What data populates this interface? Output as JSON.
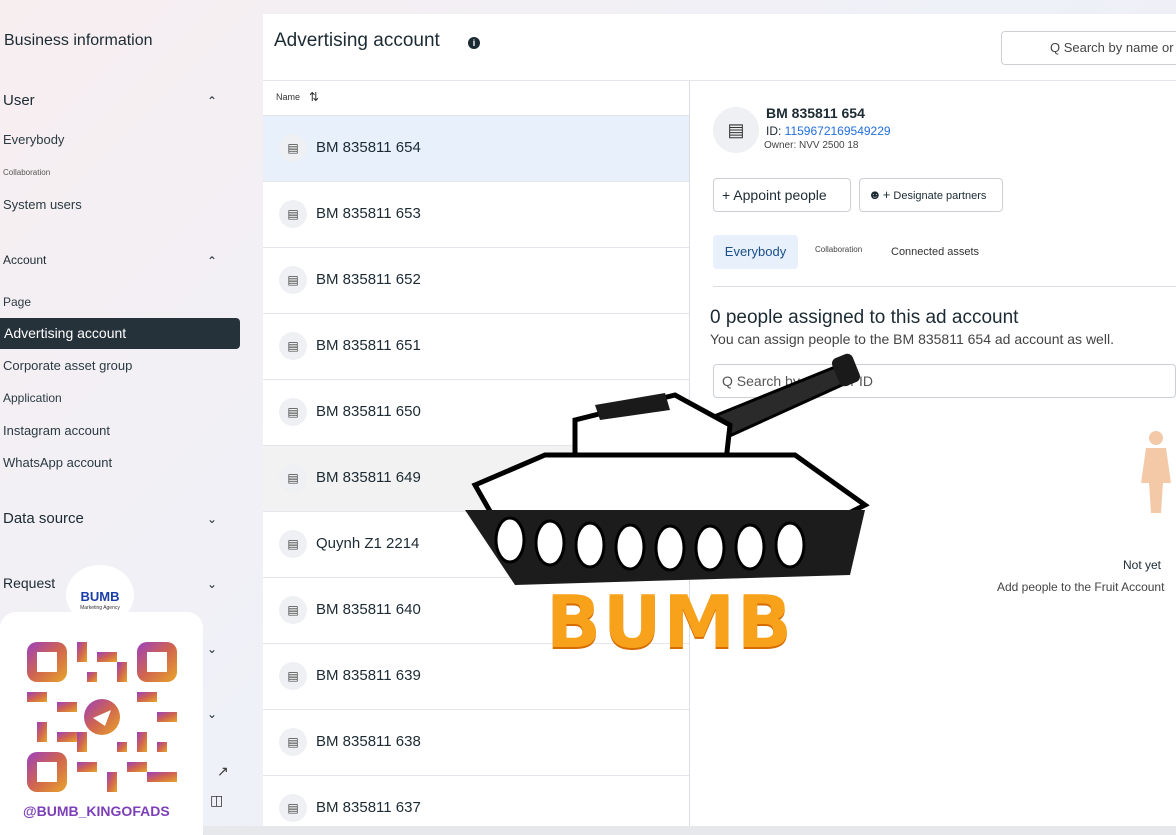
{
  "sidebar": {
    "title": "Business information",
    "sections": {
      "user": {
        "label": "User",
        "items": [
          "Everybody",
          "Collaboration",
          "System users"
        ]
      },
      "account": {
        "label": "Account",
        "items": [
          "Page",
          "Advertising account",
          "Corporate asset group",
          "Application",
          "Instagram account",
          "WhatsApp account"
        ],
        "active": "Advertising account"
      },
      "data_source": {
        "label": "Data source"
      },
      "request": {
        "label": "Request"
      }
    }
  },
  "main": {
    "title": "Advertising account",
    "search_placeholder": "Q Search by name or",
    "column_name": "Name",
    "rows": [
      "BM 835811 654",
      "BM 835811 653",
      "BM 835811 652",
      "BM 835811 651",
      "BM 835811 650",
      "BM 835811 649",
      "Quynh Z1 2214",
      "BM 835811 640",
      "BM 835811 639",
      "BM 835811 638",
      "BM 835811 637"
    ]
  },
  "detail": {
    "name": "BM 835811 654",
    "id_label": "ID: ",
    "id_value": "1159672169549229",
    "owner": "Owner: NVV 2500 18",
    "appoint_button": "+ Appoint people",
    "designate_button": "Designate partners",
    "tabs": [
      "Everybody",
      "Collaboration",
      "Connected assets"
    ],
    "empty_title": "0 people assigned to this ad account",
    "empty_subtitle": "You can assign people to the BM 835811 654 ad account as well.",
    "search_placeholder": "Q Search by name or ID",
    "not_yet": "Not yet",
    "add_people": "Add people to the Fruit Account"
  },
  "watermark": {
    "text": "BUMB",
    "logo_text": "BUMB",
    "logo_sub": "Marketing Agency",
    "handle": "@BUMB_KINGOFADS"
  },
  "colors": {
    "accent": "#216fdb",
    "active_bg": "#26323a",
    "selected_row": "#e7f0fb",
    "watermark": "#f7a21a"
  }
}
